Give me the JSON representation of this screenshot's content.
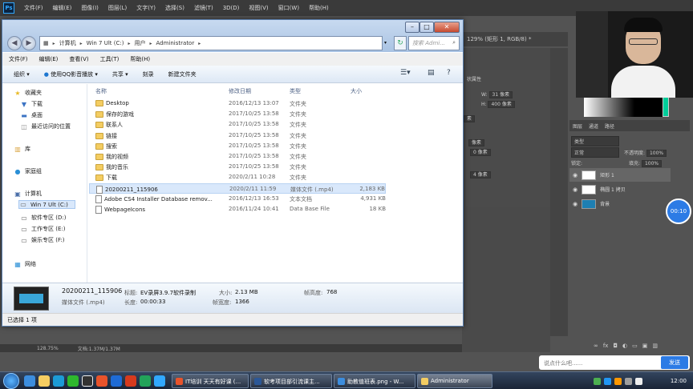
{
  "photoshop": {
    "logo": "Ps",
    "menu": [
      "文件(F)",
      "编辑(E)",
      "图像(I)",
      "图层(L)",
      "文字(Y)",
      "选择(S)",
      "滤镜(T)",
      "3D(D)",
      "视图(V)",
      "窗口(W)",
      "帮助(H)"
    ],
    "tab": "129% (矩形 1, RGB/8) *",
    "props_title": "状属性",
    "w_label": "W:",
    "w_value": "31 像素",
    "h_label": "H:",
    "h_value": "400 像素",
    "field_px1": "素",
    "field_px2": "像素",
    "field_px3": "0 像素",
    "field_px4": "4 像素",
    "layers_tabs": [
      "图层",
      "通道",
      "路径"
    ],
    "kind_filter": "类型",
    "blend_mode": "正常",
    "opacity_label": "不透明度:",
    "opacity_value": "100%",
    "lock_label": "锁定:",
    "fill_label": "填充:",
    "fill_value": "100%",
    "layers": [
      {
        "name": "矩形 1",
        "selected": true
      },
      {
        "name": "椭圆 1 拷贝",
        "selected": false
      },
      {
        "name": "背景",
        "selected": false
      }
    ],
    "status_zoom": "128.75%",
    "status_doc": "文档:1.37M/1.37M"
  },
  "explorer": {
    "breadcrumbs": [
      "计算机",
      "Win 7 Ult (C:)",
      "用户",
      "Administrator"
    ],
    "search_placeholder": "搜索 Admi...",
    "menu": [
      "文件(F)",
      "编辑(E)",
      "查看(V)",
      "工具(T)",
      "帮助(H)"
    ],
    "toolbar": [
      "组织",
      "使用QQ影音播放",
      "共享",
      "刻录",
      "新建文件夹"
    ],
    "nav": {
      "favorites": "收藏夹",
      "downloads": "下载",
      "desktop": "桌面",
      "recent": "最近访问的位置",
      "library": "库",
      "homegroup": "家庭组",
      "computer": "计算机",
      "drive_c": "Win 7 Ult (C:)",
      "drive_d": "软件专区 (D:)",
      "drive_e": "工作专区 (E:)",
      "drive_f": "娱乐专区 (F:)",
      "network": "网络"
    },
    "columns": {
      "name": "名称",
      "date": "修改日期",
      "type": "类型",
      "size": "大小"
    },
    "files": [
      {
        "name": "Desktop",
        "date": "2016/12/13 13:07",
        "type": "文件夹",
        "size": "",
        "kind": "folder"
      },
      {
        "name": "保存的游戏",
        "date": "2017/10/25 13:58",
        "type": "文件夹",
        "size": "",
        "kind": "folder"
      },
      {
        "name": "联系人",
        "date": "2017/10/25 13:58",
        "type": "文件夹",
        "size": "",
        "kind": "folder"
      },
      {
        "name": "链接",
        "date": "2017/10/25 13:58",
        "type": "文件夹",
        "size": "",
        "kind": "folder"
      },
      {
        "name": "搜索",
        "date": "2017/10/25 13:58",
        "type": "文件夹",
        "size": "",
        "kind": "folder"
      },
      {
        "name": "我的视频",
        "date": "2017/10/25 13:58",
        "type": "文件夹",
        "size": "",
        "kind": "folder"
      },
      {
        "name": "我的音乐",
        "date": "2017/10/25 13:58",
        "type": "文件夹",
        "size": "",
        "kind": "folder"
      },
      {
        "name": "下载",
        "date": "2020/2/11 10:28",
        "type": "文件夹",
        "size": "",
        "kind": "folder"
      },
      {
        "name": "20200211_115906",
        "date": "2020/2/11 11:59",
        "type": "媒体文件 (.mp4)",
        "size": "2,183 KB",
        "kind": "file",
        "selected": true
      },
      {
        "name": "Adobe CS4 Installer Database remov...",
        "date": "2016/12/13 16:53",
        "type": "文本文档",
        "size": "4,931 KB",
        "kind": "file"
      },
      {
        "name": "WebpageIcons",
        "date": "2016/11/24 10:41",
        "type": "Data Base File",
        "size": "18 KB",
        "kind": "file"
      }
    ],
    "details": {
      "filename": "20200211_115906",
      "title_label": "标题:",
      "title_value": "EV录屏3.9.7软件录制",
      "size_label": "大小:",
      "size_value": "2.13 MB",
      "framerate_label": "帧高度:",
      "framerate_value": "768",
      "filetype": "媒体文件 (.mp4)",
      "duration_label": "长度:",
      "duration_value": "00:00:33",
      "framewidth_label": "帧宽度:",
      "framewidth_value": "1366"
    },
    "status": "已选择 1 项"
  },
  "overlay": {
    "timer": "00:10",
    "comment_placeholder": "说点什么吧......",
    "send_label": "发送"
  },
  "taskbar": {
    "buttons": [
      {
        "label": "IT培训 天天有好课 (...",
        "color": "#e8532b"
      },
      {
        "label": "软考项目部引流课主...",
        "color": "#2b5797"
      },
      {
        "label": "助教值班表.png - W...",
        "color": "#3c8dde"
      },
      {
        "label": "Administrator",
        "color": "#f4cd62",
        "active": true
      }
    ],
    "clock": "12:00"
  }
}
